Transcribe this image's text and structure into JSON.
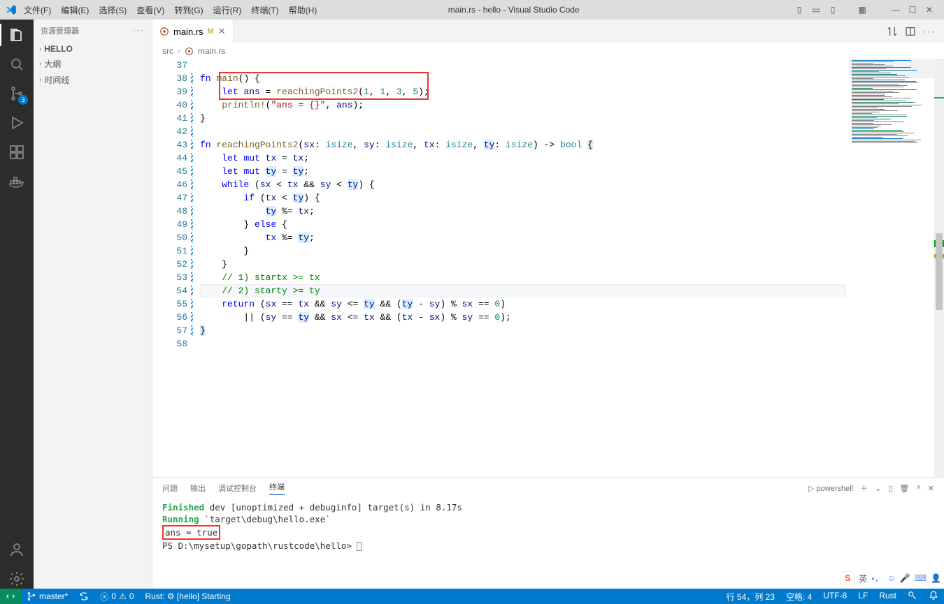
{
  "window": {
    "title": "main.rs - hello - Visual Studio Code"
  },
  "menu": {
    "file": "文件(F)",
    "edit": "编辑(E)",
    "selection": "选择(S)",
    "view": "查看(V)",
    "go": "转到(G)",
    "run": "运行(R)",
    "terminal": "终端(T)",
    "help": "帮助(H)"
  },
  "sidebar": {
    "title": "资源管理器",
    "hello": "HELLO",
    "outline": "大纲",
    "timeline": "时间线"
  },
  "activity_badge": "3",
  "tab": {
    "name": "main.rs",
    "mark": "M"
  },
  "breadcrumb": {
    "seg0": "src",
    "seg1": "main.rs"
  },
  "editor": {
    "first_line": 37,
    "lines": [
      {
        "n": 37,
        "html": ""
      },
      {
        "n": 38,
        "html": "<span class='tok-kw'>fn</span> <span class='tok-fn'>main</span>() {"
      },
      {
        "n": 39,
        "html": "    <span class='tok-kw'>let</span> <span class='tok-var'>ans</span> = <span class='tok-fn'>reachingPoints2</span>(<span class='tok-num'>1</span>, <span class='tok-num'>1</span>, <span class='tok-num'>3</span>, <span class='tok-num'>5</span>);"
      },
      {
        "n": 40,
        "html": "    <span class='tok-fn'>println!</span>(<span class='tok-str'>\"ans = {}\"</span>, <span class='tok-var'>ans</span>);"
      },
      {
        "n": 41,
        "html": "}"
      },
      {
        "n": 42,
        "html": ""
      },
      {
        "n": 43,
        "html": "<span class='tok-kw'>fn</span> <span class='tok-fn'>reachingPoints2</span>(<span class='tok-var'>sx</span>: <span class='tok-ty'>isize</span>, <span class='tok-var'>sy</span>: <span class='tok-ty'>isize</span>, <span class='tok-var'>tx</span>: <span class='tok-ty'>isize</span>, <span class='tok-var tok-hl'>ty</span>: <span class='tok-ty'>isize</span>) -&gt; <span class='tok-ty'>bool</span> <span class='tok-hl'>{</span>"
      },
      {
        "n": 44,
        "html": "    <span class='tok-kw'>let</span> <span class='tok-kw'>mut</span> <span class='tok-var'>tx</span> = <span class='tok-var'>tx</span>;"
      },
      {
        "n": 45,
        "html": "    <span class='tok-kw'>let</span> <span class='tok-kw'>mut</span> <span class='tok-var tok-hl'>ty</span> = <span class='tok-var tok-hl'>ty</span>;"
      },
      {
        "n": 46,
        "html": "    <span class='tok-kw'>while</span> (<span class='tok-var'>sx</span> &lt; <span class='tok-var'>tx</span> &amp;&amp; <span class='tok-var'>sy</span> &lt; <span class='tok-var tok-hl'>ty</span>) {"
      },
      {
        "n": 47,
        "html": "        <span class='tok-kw'>if</span> (<span class='tok-var'>tx</span> &lt; <span class='tok-var tok-hl'>ty</span>) {"
      },
      {
        "n": 48,
        "html": "            <span class='tok-var tok-hl'>ty</span> %= <span class='tok-var'>tx</span>;"
      },
      {
        "n": 49,
        "html": "        } <span class='tok-kw'>else</span> {"
      },
      {
        "n": 50,
        "html": "            <span class='tok-var'>tx</span> %= <span class='tok-var tok-hl'>ty</span>;"
      },
      {
        "n": 51,
        "html": "        }"
      },
      {
        "n": 52,
        "html": "    }"
      },
      {
        "n": 53,
        "html": "    <span class='tok-cm'>// 1) startx &gt;= tx</span>"
      },
      {
        "n": 54,
        "html": "    <span class='tok-cm'>// 2) starty &gt;= ty</span>",
        "current": true
      },
      {
        "n": 55,
        "html": "    <span class='tok-kw'>return</span> (<span class='tok-var'>sx</span> == <span class='tok-var'>tx</span> &amp;&amp; <span class='tok-var'>sy</span> &lt;= <span class='tok-var tok-hl'>ty</span> &amp;&amp; (<span class='tok-var tok-hl'>ty</span> - <span class='tok-var'>sy</span>) % <span class='tok-var'>sx</span> == <span class='tok-num'>0</span>)"
      },
      {
        "n": 56,
        "html": "        || (<span class='tok-var'>sy</span> == <span class='tok-var tok-hl'>ty</span> &amp;&amp; <span class='tok-var'>sx</span> &lt;= <span class='tok-var'>tx</span> &amp;&amp; (<span class='tok-var'>tx</span> - <span class='tok-var'>sx</span>) % <span class='tok-var'>sy</span> == <span class='tok-num'>0</span>);"
      },
      {
        "n": 57,
        "html": "<span class='tok-hl'>}</span>"
      },
      {
        "n": 58,
        "html": ""
      }
    ]
  },
  "panel": {
    "problems": "问题",
    "output": "输出",
    "debug": "调试控制台",
    "terminal": "终端"
  },
  "terminal": {
    "shell": "powershell",
    "l1a": "Finished",
    "l1b": " dev [unoptimized + debuginfo] target(s) in 8.17s",
    "l2a": "Running",
    "l2b": " `target\\debug\\hello.exe`",
    "l3": "ans = true",
    "l4a": "PS ",
    "l4b": "D:\\mysetup\\gopath\\rustcode\\hello",
    "l4c": "> "
  },
  "status": {
    "branch": "master*",
    "errors": "0",
    "warnings": "0",
    "rust": "Rust: ⚙ [hello] Starting",
    "lncol": "行 54，列 23",
    "spaces": "空格: 4",
    "enc": "UTF-8",
    "eol": "LF",
    "lang": "Rust"
  },
  "ime": {
    "lang": "英"
  }
}
